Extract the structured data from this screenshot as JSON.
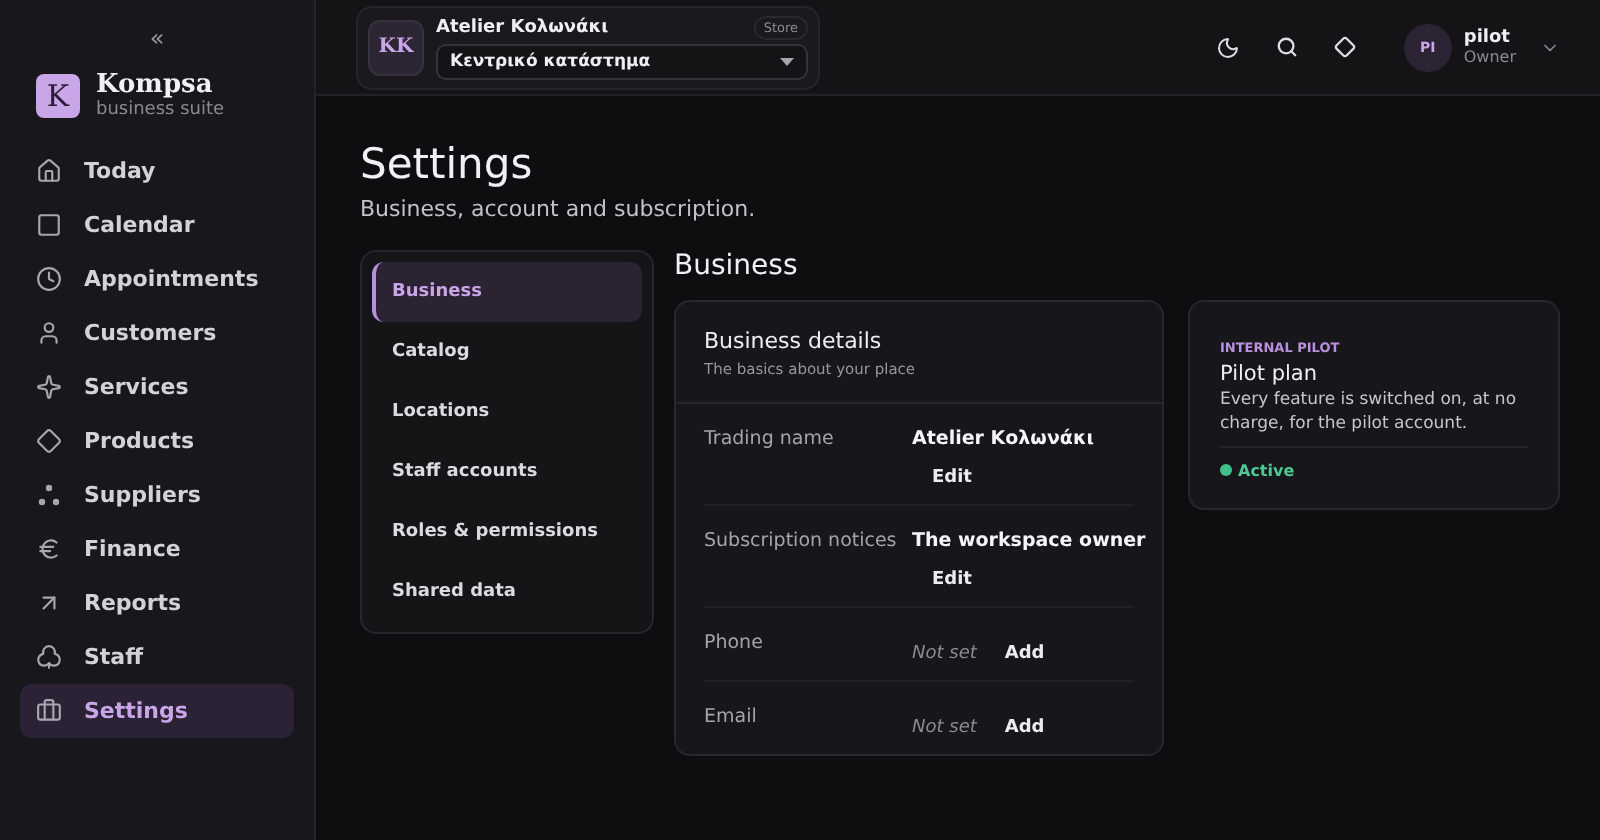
{
  "sidebar": {
    "collapse": "«",
    "brand": {
      "logo": "K",
      "name": "Kompsa",
      "tagline": "business suite"
    },
    "items": [
      {
        "label": "Today",
        "selected": false
      },
      {
        "label": "Calendar",
        "selected": false
      },
      {
        "label": "Appointments",
        "selected": false
      },
      {
        "label": "Customers",
        "selected": false
      },
      {
        "label": "Services",
        "selected": false
      },
      {
        "label": "Products",
        "selected": false
      },
      {
        "label": "Suppliers",
        "selected": false
      },
      {
        "label": "Finance",
        "selected": false
      },
      {
        "label": "Reports",
        "selected": false
      },
      {
        "label": "Staff",
        "selected": false
      },
      {
        "label": "Settings",
        "selected": true
      }
    ]
  },
  "topbar": {
    "store": {
      "initials": "KK",
      "name": "Atelier Κολωνάκι",
      "badge": "Store",
      "location": "Κεντρικό κατάστημα"
    },
    "user": {
      "initials": "PI",
      "name": "pilot",
      "role": "Owner"
    }
  },
  "page": {
    "title": "Settings",
    "subtitle": "Business, account and subscription."
  },
  "settings_nav": [
    {
      "label": "Business",
      "selected": true
    },
    {
      "label": "Catalog",
      "selected": false
    },
    {
      "label": "Locations",
      "selected": false
    },
    {
      "label": "Staff accounts",
      "selected": false
    },
    {
      "label": "Roles & permissions",
      "selected": false
    },
    {
      "label": "Shared data",
      "selected": false
    }
  ],
  "section": {
    "title": "Business",
    "details": {
      "title": "Business details",
      "subtitle": "The basics about your place",
      "rows": [
        {
          "kind": "filled",
          "label": "Trading name",
          "value": "Atelier Κολωνάκι",
          "action": "Edit"
        },
        {
          "kind": "filled",
          "label": "Subscription notices",
          "value": "The workspace owner",
          "action": "Edit"
        },
        {
          "kind": "empty",
          "label": "Phone",
          "value": "Not set",
          "action": "Add"
        },
        {
          "kind": "empty",
          "label": "Email",
          "value": "Not set",
          "action": "Add"
        }
      ]
    },
    "plan": {
      "eyebrow": "INTERNAL PILOT",
      "title": "Pilot plan",
      "description": "Every feature is switched on, at no charge, for the pilot account.",
      "status": {
        "label": "Active",
        "color": "#3ec28a"
      }
    }
  }
}
